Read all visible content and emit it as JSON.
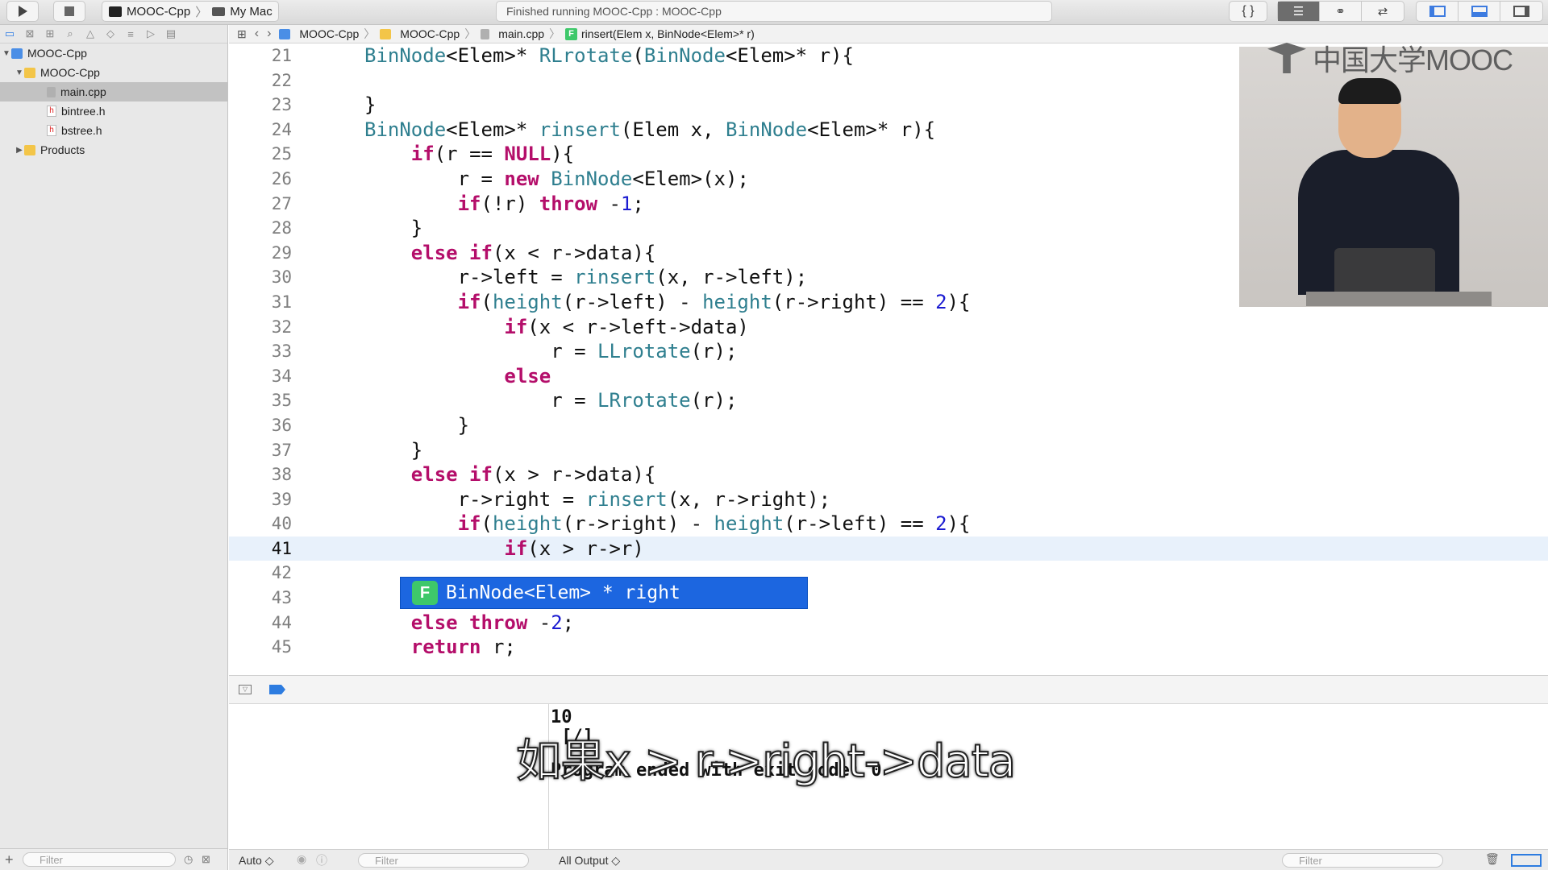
{
  "toolbar": {
    "scheme_name": "MOOC-Cpp",
    "destination": "My Mac",
    "status_text": "Finished running MOOC-Cpp : MOOC-Cpp"
  },
  "navigator": {
    "items": [
      {
        "label": "MOOC-Cpp",
        "kind": "project"
      },
      {
        "label": "MOOC-Cpp",
        "kind": "folder"
      },
      {
        "label": "main.cpp",
        "kind": "cpp"
      },
      {
        "label": "bintree.h",
        "kind": "header"
      },
      {
        "label": "bstree.h",
        "kind": "header"
      },
      {
        "label": "Products",
        "kind": "folder"
      }
    ],
    "filter_placeholder": "Filter"
  },
  "jumpbar": {
    "crumbs": [
      "MOOC-Cpp",
      "MOOC-Cpp",
      "main.cpp",
      "rinsert(Elem x, BinNode<Elem>* r)"
    ]
  },
  "editor": {
    "current_line": 41,
    "lines": [
      {
        "n": "21",
        "code": "BinNode<Elem>* RLrotate(BinNode<Elem>* r){"
      },
      {
        "n": "22",
        "code": ""
      },
      {
        "n": "23",
        "code": "}"
      },
      {
        "n": "24",
        "code": "BinNode<Elem>* rinsert(Elem x, BinNode<Elem>* r){"
      },
      {
        "n": "25",
        "code": "    if(r == NULL){"
      },
      {
        "n": "26",
        "code": "        r = new BinNode<Elem>(x);"
      },
      {
        "n": "27",
        "code": "        if(!r) throw -1;"
      },
      {
        "n": "28",
        "code": "    }"
      },
      {
        "n": "29",
        "code": "    else if(x < r->data){"
      },
      {
        "n": "30",
        "code": "        r->left = rinsert(x, r->left);"
      },
      {
        "n": "31",
        "code": "        if(height(r->left) - height(r->right) == 2){"
      },
      {
        "n": "32",
        "code": "            if(x < r->left->data)"
      },
      {
        "n": "33",
        "code": "                r = LLrotate(r);"
      },
      {
        "n": "34",
        "code": "            else"
      },
      {
        "n": "35",
        "code": "                r = LRrotate(r);"
      },
      {
        "n": "36",
        "code": "        }"
      },
      {
        "n": "37",
        "code": "    }"
      },
      {
        "n": "38",
        "code": "    else if(x > r->data){"
      },
      {
        "n": "39",
        "code": "        r->right = rinsert(x, r->right);"
      },
      {
        "n": "40",
        "code": "        if(height(r->right) - height(r->left) == 2){"
      },
      {
        "n": "41",
        "code": "            if(x > r->r)"
      },
      {
        "n": "42",
        "code": ""
      },
      {
        "n": "43",
        "code": "    }"
      },
      {
        "n": "44",
        "code": "    else throw -2;"
      },
      {
        "n": "45",
        "code": "    return r;"
      }
    ]
  },
  "completion": {
    "badge": "F",
    "text": "BinNode<Elem> * right"
  },
  "watermark": {
    "logo_text": "中国大学MOOC"
  },
  "console": {
    "lines": [
      "10",
      " [/]",
      "Program ended with exit code: 0"
    ]
  },
  "debug_bottom": {
    "auto_label": "Auto ◇",
    "filter_placeholder": "Filter",
    "output_label": "All Output ◇"
  },
  "subtitle": "如果x > r->right->data"
}
